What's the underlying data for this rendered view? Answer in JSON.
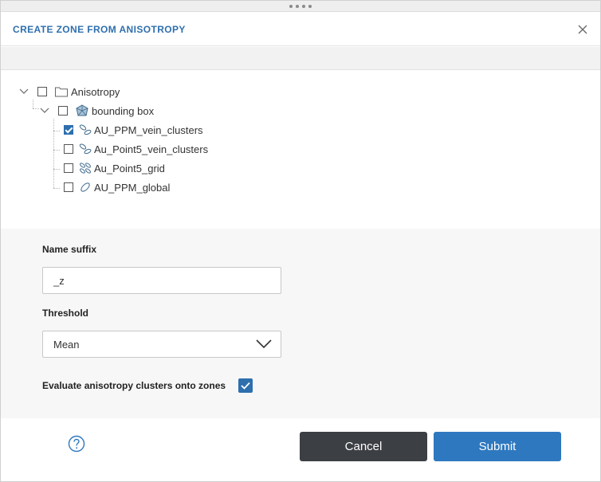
{
  "dialog": {
    "title": "CREATE ZONE FROM ANISOTROPY",
    "close_icon": "close-icon"
  },
  "tree": {
    "root": {
      "label": "Anisotropy",
      "icon": "folder-icon",
      "checked": false,
      "expanded": true
    },
    "group": {
      "label": "bounding box",
      "icon": "polyhedron-icon",
      "checked": false,
      "expanded": true
    },
    "items": [
      {
        "label": "AU_PPM_vein_clusters",
        "icon": "anisotropy-clusters-icon",
        "checked": true
      },
      {
        "label": "Au_Point5_vein_clusters",
        "icon": "anisotropy-clusters-icon",
        "checked": false
      },
      {
        "label": "Au_Point5_grid",
        "icon": "anisotropy-grid-icon",
        "checked": false
      },
      {
        "label": "AU_PPM_global",
        "icon": "ellipse-icon",
        "checked": false
      }
    ]
  },
  "form": {
    "name_suffix_label": "Name suffix",
    "name_suffix_value": "_z",
    "threshold_label": "Threshold",
    "threshold_value": "Mean",
    "evaluate_label": "Evaluate anisotropy clusters onto zones",
    "evaluate_checked": true
  },
  "footer": {
    "help_icon": "help-icon",
    "cancel_label": "Cancel",
    "submit_label": "Submit"
  },
  "colors": {
    "accent": "#2e6fae",
    "submit": "#2e78bf",
    "cancel": "#3c3f44"
  }
}
